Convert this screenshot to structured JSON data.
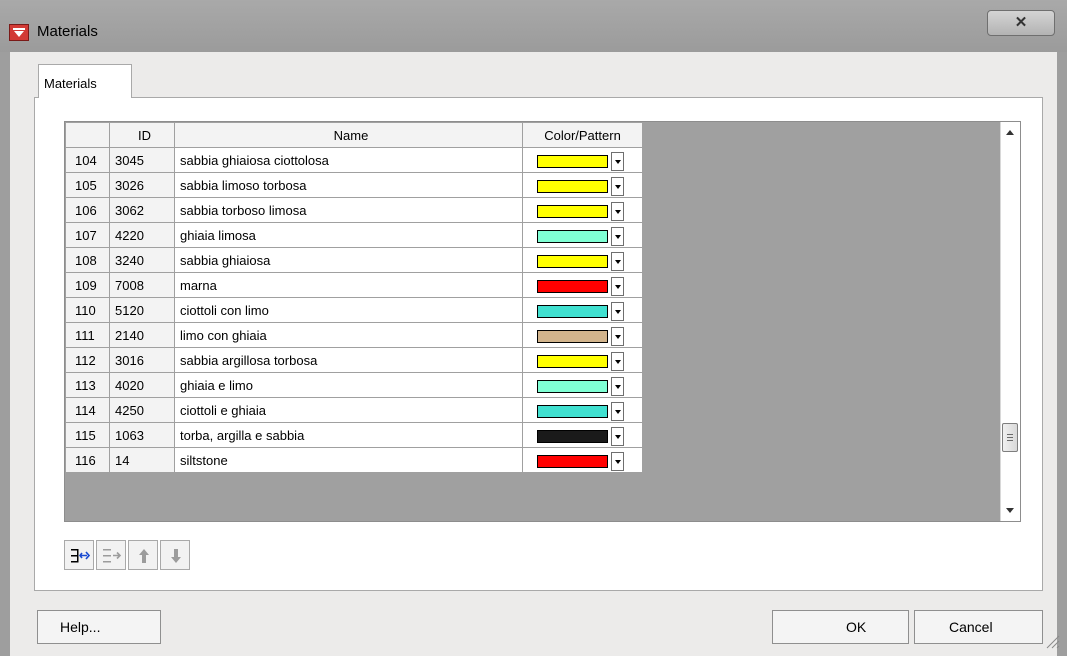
{
  "window": {
    "title": "Materials",
    "close_glyph": "✕"
  },
  "tab": {
    "label": "Materials"
  },
  "grid": {
    "headers": [
      "",
      "ID",
      "Name",
      "Color/Pattern"
    ],
    "rows": [
      {
        "row": "104",
        "id": "3045",
        "name": "sabbia ghiaiosa ciottolosa",
        "color": "#ffff00"
      },
      {
        "row": "105",
        "id": "3026",
        "name": "sabbia limoso torbosa",
        "color": "#ffff00"
      },
      {
        "row": "106",
        "id": "3062",
        "name": "sabbia torboso limosa",
        "color": "#ffff00"
      },
      {
        "row": "107",
        "id": "4220",
        "name": "ghiaia limosa",
        "color": "#7fffd4"
      },
      {
        "row": "108",
        "id": "3240",
        "name": "sabbia ghiaiosa",
        "color": "#ffff00"
      },
      {
        "row": "109",
        "id": "7008",
        "name": "marna",
        "color": "#ff0000"
      },
      {
        "row": "110",
        "id": "5120",
        "name": "ciottoli con limo",
        "color": "#40e0d0"
      },
      {
        "row": "111",
        "id": "2140",
        "name": "limo con ghiaia",
        "color": "#d2b48c"
      },
      {
        "row": "112",
        "id": "3016",
        "name": "sabbia argillosa torbosa",
        "color": "#ffff00"
      },
      {
        "row": "113",
        "id": "4020",
        "name": "ghiaia e limo",
        "color": "#7fffd4"
      },
      {
        "row": "114",
        "id": "4250",
        "name": "ciottoli e ghiaia",
        "color": "#40e0d0"
      },
      {
        "row": "115",
        "id": "1063",
        "name": "torba, argilla e sabbia",
        "color": "#1a1a1a"
      },
      {
        "row": "116",
        "id": "14",
        "name": "siltstone",
        "color": "#ff0000"
      }
    ]
  },
  "toolbar": {
    "icons": [
      "insert-row-icon",
      "append-row-icon",
      "move-up-icon",
      "move-down-icon"
    ]
  },
  "buttons": {
    "help": "Help...",
    "ok": "OK",
    "cancel": "Cancel"
  }
}
